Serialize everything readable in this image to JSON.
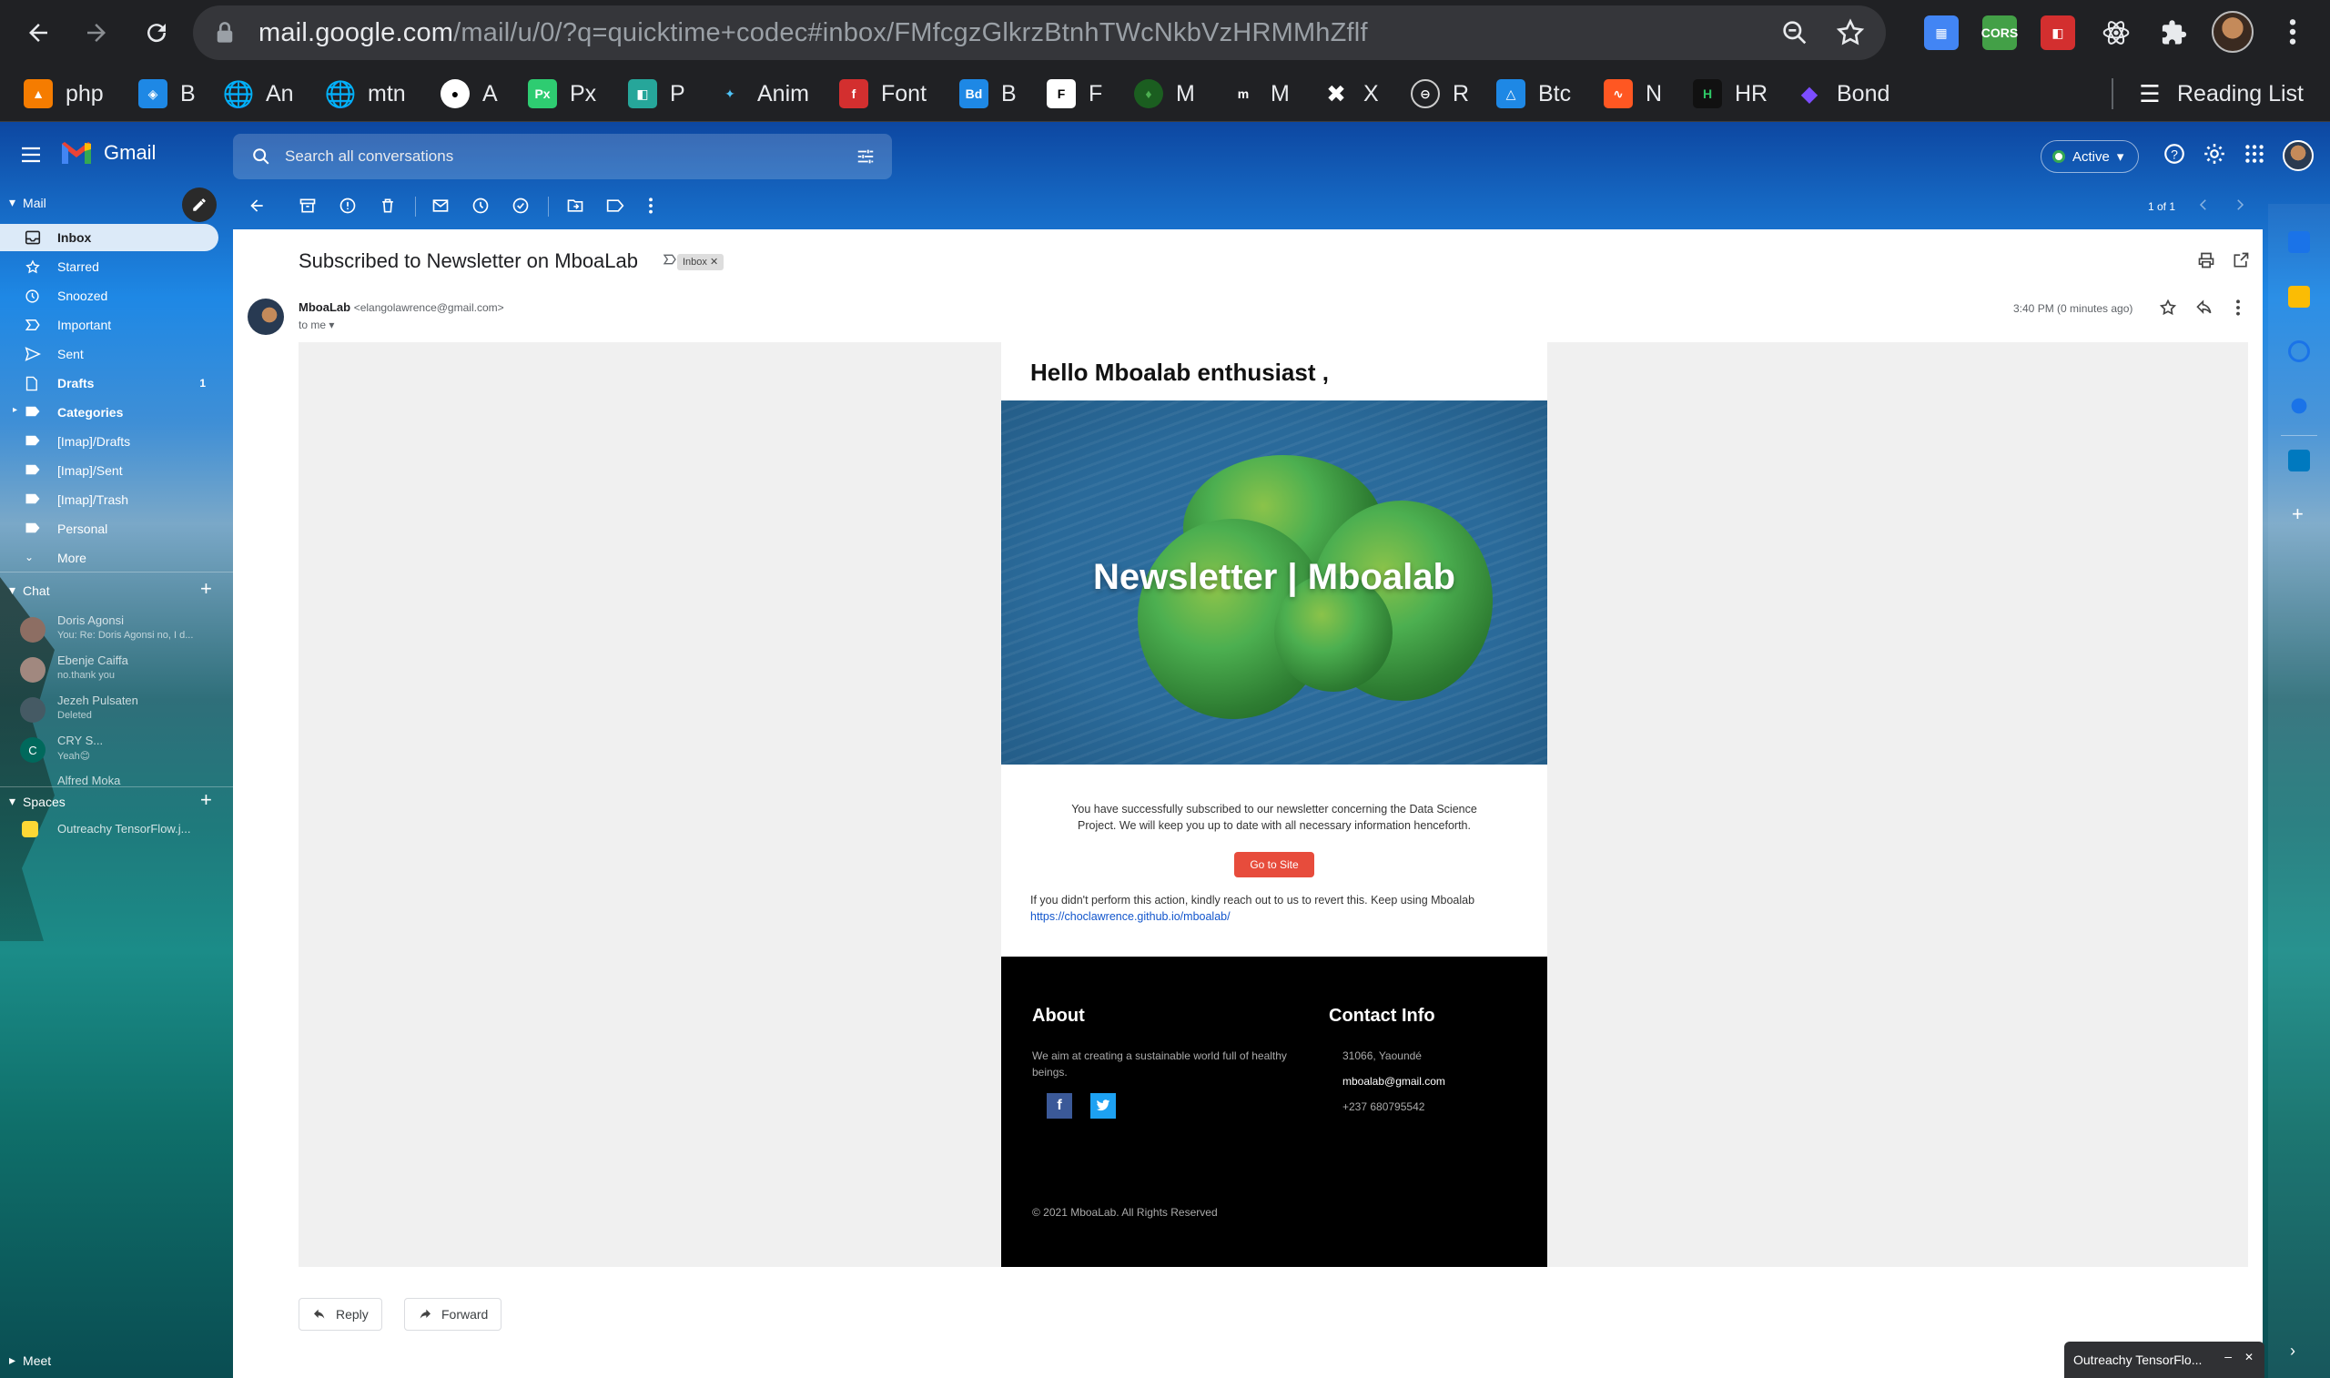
{
  "browser": {
    "url_host": "mail.google.com",
    "url_path": "/mail/u/0/?q=quicktime+codec#inbox/FMfcgzGlkrzBtnhTWcNkbVzHRMMhZflf",
    "extensions": [
      "CORS"
    ],
    "bookmarks": [
      "php",
      "B",
      "An",
      "mtn",
      "A",
      "Px",
      "P",
      "Anim",
      "Font",
      "B",
      "F",
      "M",
      "M",
      "X",
      "R",
      "Btc",
      "N",
      "HR",
      "Bond"
    ],
    "bookmark_icons": [
      "Px",
      "Bd",
      "m",
      "H"
    ],
    "reading_list": "Reading List"
  },
  "gmail": {
    "app_name": "Gmail",
    "search_placeholder": "Search all conversations",
    "status": "Active",
    "pager": "1 of 1",
    "sidebar": {
      "mail_label": "Mail",
      "items": [
        {
          "label": "Inbox",
          "count": ""
        },
        {
          "label": "Starred",
          "count": ""
        },
        {
          "label": "Snoozed",
          "count": ""
        },
        {
          "label": "Important",
          "count": ""
        },
        {
          "label": "Sent",
          "count": ""
        },
        {
          "label": "Drafts",
          "count": "1"
        },
        {
          "label": "Categories",
          "count": ""
        },
        {
          "label": "[Imap]/Drafts",
          "count": ""
        },
        {
          "label": "[Imap]/Sent",
          "count": ""
        },
        {
          "label": "[Imap]/Trash",
          "count": ""
        },
        {
          "label": "Personal",
          "count": ""
        },
        {
          "label": "More",
          "count": ""
        }
      ],
      "chat_label": "Chat",
      "chats": [
        {
          "name": "Doris Agonsi",
          "initial": "",
          "msg": "You: Re: Doris Agonsi no, I d..."
        },
        {
          "name": "Ebenje Caiffa",
          "initial": "",
          "msg": "no.thank you"
        },
        {
          "name": "Jezeh Pulsaten",
          "initial": "",
          "msg": "Deleted"
        },
        {
          "name": "CRY S...",
          "initial": "C",
          "msg": "Yeah😊"
        },
        {
          "name": "Alfred Moka",
          "initial": "",
          "msg": ""
        }
      ],
      "spaces_label": "Spaces",
      "spaces": [
        {
          "name": "Outreachy TensorFlow.j..."
        }
      ],
      "meet_label": "Meet"
    },
    "message": {
      "subject": "Subscribed to Newsletter on MboaLab",
      "label_chip": "Inbox",
      "sender_name": "MboaLab",
      "sender_email": "<elangolawrence@gmail.com>",
      "to": "to me",
      "time": "3:40 PM (0 minutes ago)"
    },
    "email": {
      "greeting": "Hello Mboalab enthusiast ,",
      "hero_title": "Newsletter | Mboalab",
      "body": "You have successfully subscribed to our newsletter concerning the Data Science Project. We will keep you up to date with all necessary information henceforth.",
      "cta": "Go to Site",
      "note": "If you didn't perform this action, kindly reach out to us to revert this. Keep using Mboalab",
      "link": "https://choclawrence.github.io/mboalab/",
      "about_title": "About",
      "about_text": "We aim at creating a sustainable world full of healthy beings.",
      "contact_title": "Contact Info",
      "address": "31066, Yaoundé",
      "email": "mboalab@gmail.com",
      "phone": "+237 680795542",
      "copyright": "© 2021 MboaLab. All Rights Reserved"
    },
    "actions": {
      "reply": "Reply",
      "forward": "Forward"
    },
    "chat_popup": "Outreachy TensorFlo..."
  }
}
